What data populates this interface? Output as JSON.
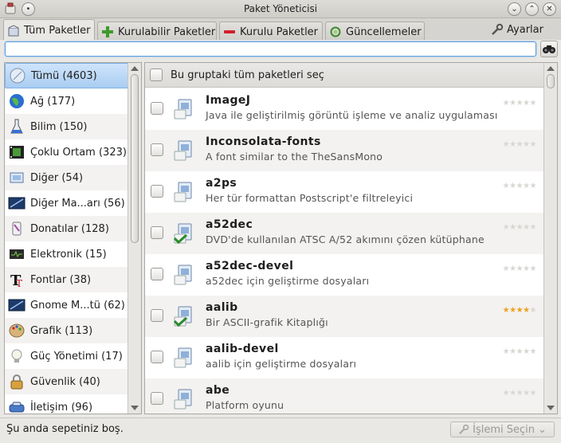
{
  "window": {
    "title": "Paket Yöneticisi"
  },
  "tabs": [
    {
      "label": "Tüm Paketler",
      "icon": "package-icon"
    },
    {
      "label": "Kurulabilir Paketler",
      "icon": "plus-icon"
    },
    {
      "label": "Kurulu Paketler",
      "icon": "minus-icon"
    },
    {
      "label": "Güncellemeler",
      "icon": "refresh-icon"
    }
  ],
  "settings_label": "Ayarlar",
  "search": {
    "value": "",
    "placeholder": ""
  },
  "sidebar": {
    "items": [
      {
        "label": "Tümü (4603)",
        "icon": "all-icon",
        "selected": true
      },
      {
        "label": "Ağ (177)",
        "icon": "globe-icon"
      },
      {
        "label": "Bilim (150)",
        "icon": "flask-icon"
      },
      {
        "label": "Çoklu Ortam (323)",
        "icon": "film-icon"
      },
      {
        "label": "Diğer (54)",
        "icon": "other-icon"
      },
      {
        "label": "Diğer Ma...arı (56)",
        "icon": "desktop-icon"
      },
      {
        "label": "Donatılar (128)",
        "icon": "accessories-icon"
      },
      {
        "label": "Elektronik (15)",
        "icon": "electronics-icon"
      },
      {
        "label": "Fontlar (38)",
        "icon": "font-icon"
      },
      {
        "label": "Gnome M...tü (62)",
        "icon": "gnome-icon"
      },
      {
        "label": "Grafik (113)",
        "icon": "palette-icon"
      },
      {
        "label": "Güç Yönetimi (17)",
        "icon": "bulb-icon"
      },
      {
        "label": "Güvenlik (40)",
        "icon": "lock-icon"
      },
      {
        "label": "İletişim (96)",
        "icon": "phone-icon"
      }
    ]
  },
  "select_all_label": "Bu gruptaki tüm paketleri seç",
  "packages": [
    {
      "name": "ImageJ",
      "desc": "Java ile geliştirilmiş görüntü işleme ve analiz uygulaması",
      "installed": false,
      "rating": 0
    },
    {
      "name": "Inconsolata-fonts",
      "desc": "A font similar to the TheSansMono",
      "installed": false,
      "rating": 0
    },
    {
      "name": "a2ps",
      "desc": "Her tür formattan Postscript'e filtreleyici",
      "installed": false,
      "rating": 0
    },
    {
      "name": "a52dec",
      "desc": "DVD'de kullanılan ATSC A/52 akımını çözen kütüphane",
      "installed": true,
      "rating": 0
    },
    {
      "name": "a52dec-devel",
      "desc": "a52dec için geliştirme dosyaları",
      "installed": false,
      "rating": 0
    },
    {
      "name": "aalib",
      "desc": "Bir ASCII-grafik Kitaplığı",
      "installed": true,
      "rating": 4
    },
    {
      "name": "aalib-devel",
      "desc": "aalib için geliştirme dosyaları",
      "installed": false,
      "rating": 0
    },
    {
      "name": "abe",
      "desc": "Platform oyunu",
      "installed": false,
      "rating": 0
    }
  ],
  "status": {
    "message": "Şu anda sepetiniz boş.",
    "action_label": "İşlemi Seçin"
  },
  "colors": {
    "selection": "#a9cdf2",
    "accent": "#5a9be0",
    "star": "#f0a020"
  }
}
